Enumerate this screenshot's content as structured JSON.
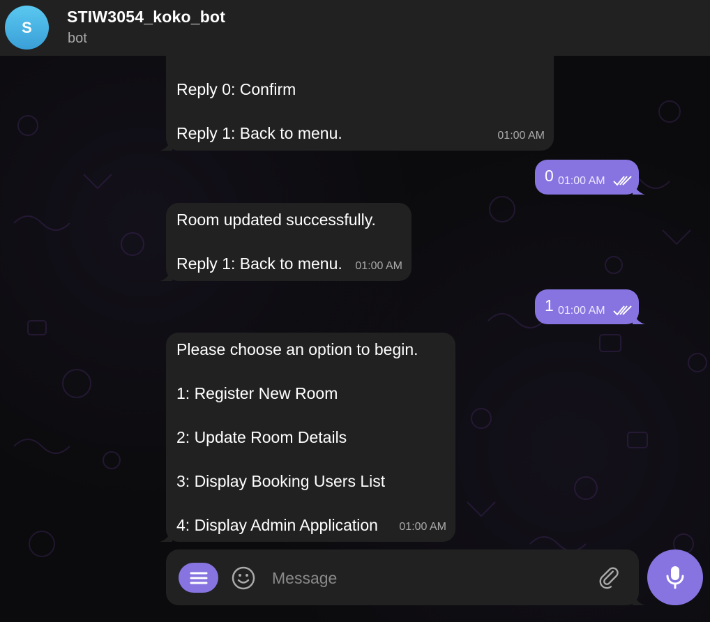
{
  "header": {
    "avatar_letter": "S",
    "title": "STIW3054_koko_bot",
    "subtitle": "bot"
  },
  "messages": {
    "m1": {
      "lines": [
        "Reply 0: Confirm",
        "",
        "Reply 1: Back to menu."
      ],
      "time": "01:00 AM"
    },
    "m2": {
      "text": "0",
      "time": "01:00 AM"
    },
    "m3": {
      "lines": [
        "Room updated successfully.",
        "",
        "Reply 1: Back to menu."
      ],
      "time": "01:00 AM"
    },
    "m4": {
      "text": "1",
      "time": "01:00 AM"
    },
    "m5": {
      "lines": [
        "Please choose an option to begin.",
        "",
        "1: Register New Room",
        "",
        "2: Update Room Details",
        "",
        "3: Display Booking Users List",
        "",
        "4: Display Admin Application"
      ],
      "time": "01:00 AM"
    }
  },
  "composer": {
    "placeholder": "Message",
    "menu_icon": "menu-icon",
    "emoji_icon": "smile-icon",
    "attach_icon": "paperclip-icon",
    "mic_icon": "microphone-icon"
  },
  "colors": {
    "accent": "#8774e1",
    "bubble": "#212121",
    "header": "#212121"
  }
}
